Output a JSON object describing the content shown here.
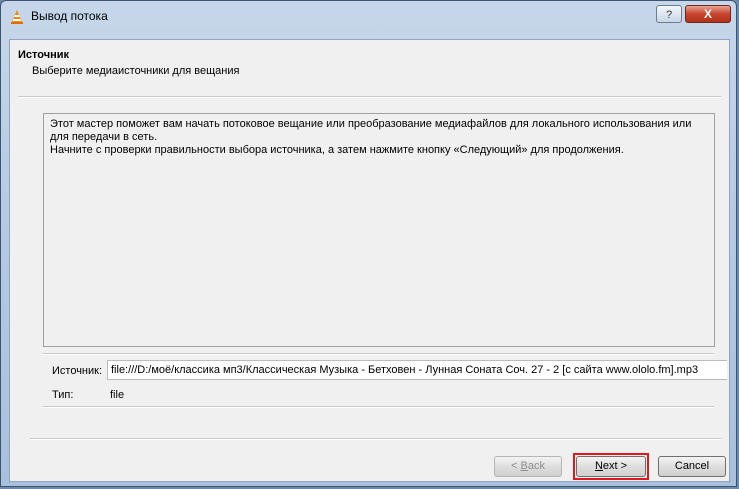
{
  "window": {
    "title": "Вывод потока",
    "help_label": "?",
    "close_label": "X"
  },
  "header": {
    "title": "Источник",
    "subtitle": "Выберите медиаисточники для вещания"
  },
  "description": {
    "line1": "Этот мастер поможет вам начать потоковое вещание или преобразование медиафайлов для локального использования или для передачи в сеть.",
    "line2": "Начните с проверки правильности выбора источника, а затем нажмите кнопку «Следующий» для продолжения."
  },
  "source": {
    "label": "Источник:",
    "value": "file:///D:/моё/классика мп3/Классическая Музыка - Бетховен - Лунная Соната Соч. 27 - 2 [с сайта www.ololo.fm].mp3"
  },
  "type": {
    "label": "Тип:",
    "value": "file"
  },
  "buttons": {
    "back_prefix": "< ",
    "back_mnemonic": "B",
    "back_rest": "ack",
    "next_mnemonic": "N",
    "next_rest": "ext >",
    "cancel": "Cancel"
  },
  "colors": {
    "highlight": "#e0191d"
  },
  "icons": {
    "app": "vlc-cone-icon"
  }
}
